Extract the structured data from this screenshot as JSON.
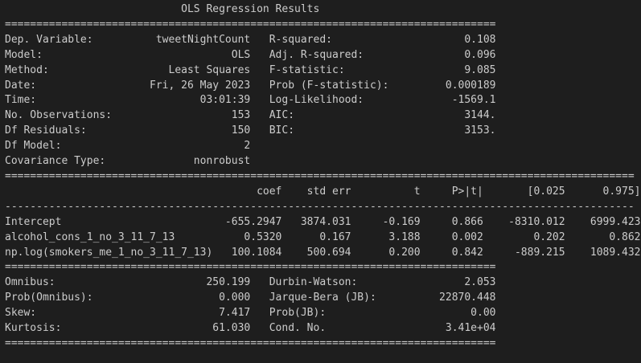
{
  "title": "OLS Regression Results",
  "sep_eq_78": "==============================================================================",
  "sep_eq_100": "====================================================================================================",
  "sep_dash_100": "----------------------------------------------------------------------------------------------------",
  "summary_rows": [
    {
      "l_label": "Dep. Variable:",
      "l_value": "tweetNightCount",
      "r_label": "R-squared:",
      "r_value": "0.108"
    },
    {
      "l_label": "Model:",
      "l_value": "OLS",
      "r_label": "Adj. R-squared:",
      "r_value": "0.096"
    },
    {
      "l_label": "Method:",
      "l_value": "Least Squares",
      "r_label": "F-statistic:",
      "r_value": "9.085"
    },
    {
      "l_label": "Date:",
      "l_value": "Fri, 26 May 2023",
      "r_label": "Prob (F-statistic):",
      "r_value": "0.000189"
    },
    {
      "l_label": "Time:",
      "l_value": "03:01:39",
      "r_label": "Log-Likelihood:",
      "r_value": "-1569.1"
    },
    {
      "l_label": "No. Observations:",
      "l_value": "153",
      "r_label": "AIC:",
      "r_value": "3144."
    },
    {
      "l_label": "Df Residuals:",
      "l_value": "150",
      "r_label": "BIC:",
      "r_value": "3153."
    },
    {
      "l_label": "Df Model:",
      "l_value": "2",
      "r_label": "",
      "r_value": ""
    },
    {
      "l_label": "Covariance Type:",
      "l_value": "nonrobust",
      "r_label": "",
      "r_value": ""
    }
  ],
  "coef_headers": [
    "coef",
    "std err",
    "t",
    "P>|t|",
    "[0.025",
    "0.975]"
  ],
  "coef_rows": [
    {
      "name": "Intercept",
      "values": [
        "-655.2947",
        "3874.031",
        "-0.169",
        "0.866",
        "-8310.012",
        "6999.423"
      ]
    },
    {
      "name": "alcohol_cons_1_no_3_11_7_13",
      "values": [
        "0.5320",
        "0.167",
        "3.188",
        "0.002",
        "0.202",
        "0.862"
      ]
    },
    {
      "name": "np.log(smokers_me_1_no_3_11_7_13)",
      "values": [
        "100.1084",
        "500.694",
        "0.200",
        "0.842",
        "-889.215",
        "1089.432"
      ]
    }
  ],
  "diag_rows": [
    {
      "l_label": "Omnibus:",
      "l_value": "250.199",
      "r_label": "Durbin-Watson:",
      "r_value": "2.053"
    },
    {
      "l_label": "Prob(Omnibus):",
      "l_value": "0.000",
      "r_label": "Jarque-Bera (JB):",
      "r_value": "22870.448"
    },
    {
      "l_label": "Skew:",
      "l_value": "7.417",
      "r_label": "Prob(JB):",
      "r_value": "0.00"
    },
    {
      "l_label": "Kurtosis:",
      "l_value": "61.030",
      "r_label": "Cond. No.",
      "r_value": "3.41e+04"
    }
  ]
}
